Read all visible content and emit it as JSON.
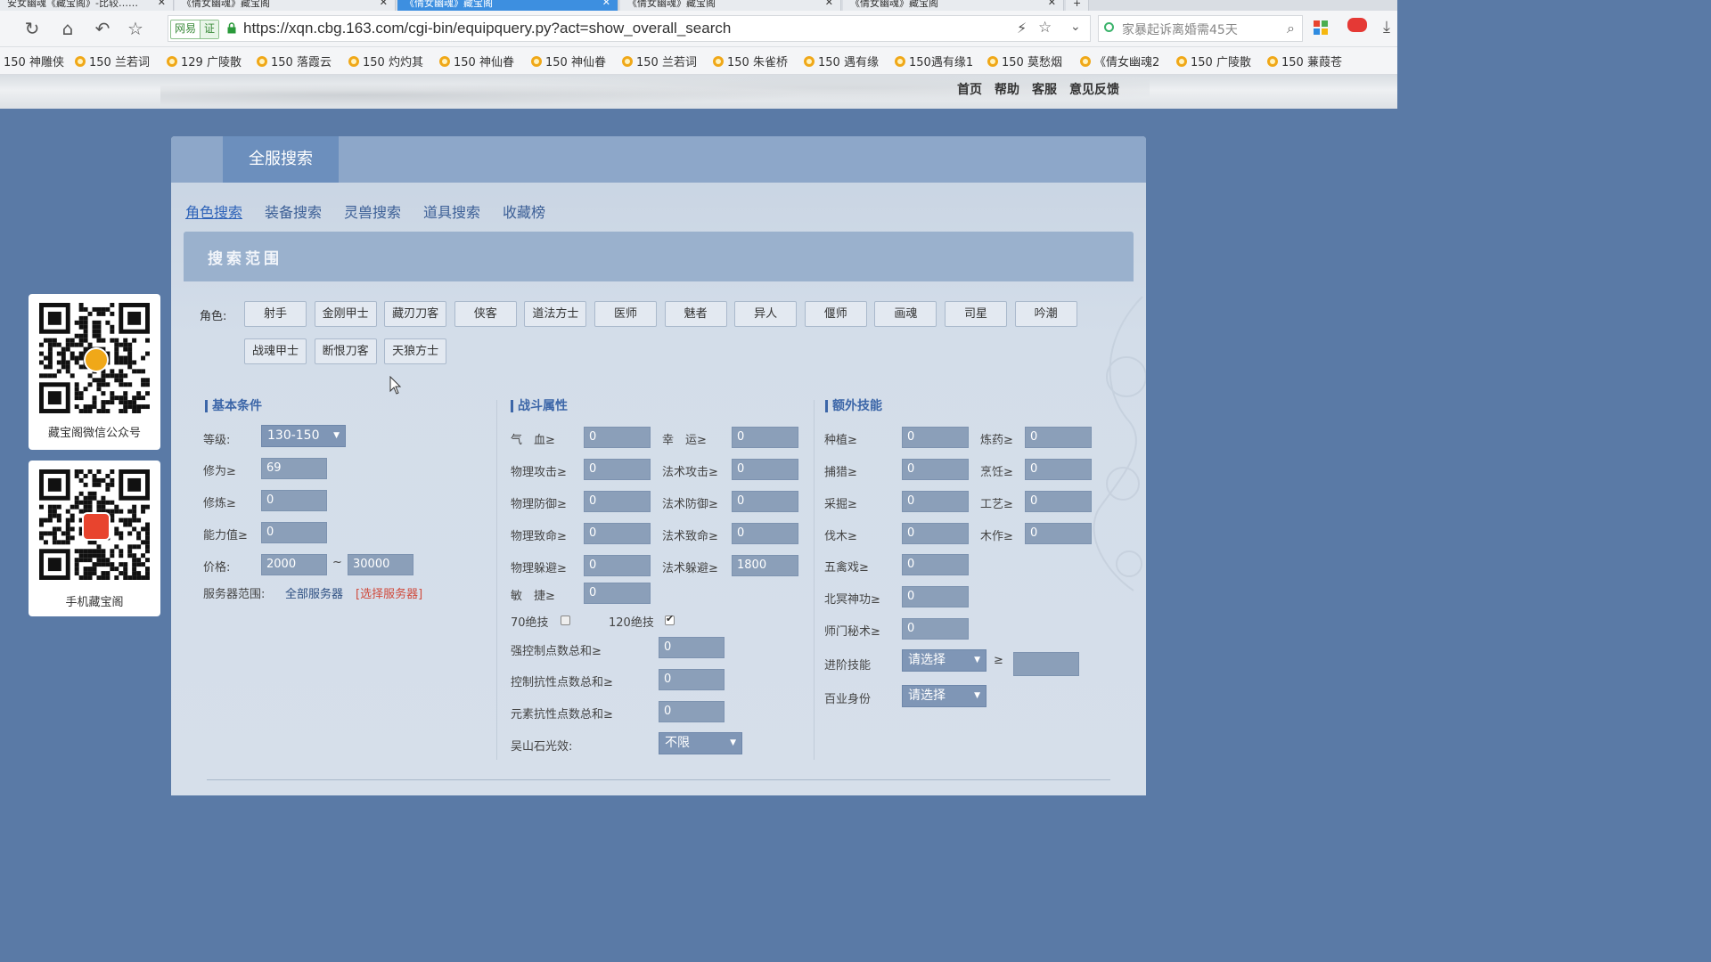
{
  "browser": {
    "tabs": [
      {
        "label": "安女幽魂《藏宝阁》-比较……"
      },
      {
        "label": "《倩女幽魂》藏宝阁"
      },
      {
        "label": "《倩女幽魂》藏宝阁",
        "active": true
      },
      {
        "label": "《倩女幽魂》藏宝阁"
      },
      {
        "label": "《倩女幽魂》藏宝阁"
      }
    ],
    "security_badge": [
      "网易",
      "证"
    ],
    "url": "https://xqn.cbg.163.com/cgi-bin/equipquery.py?act=show_overall_search",
    "search_placeholder": "家暴起诉离婚需45天",
    "bookmarks": [
      "150 神雕侠",
      "150 兰若词",
      "129 广陵散",
      "150 落霞云",
      "150 灼灼其",
      "150 神仙眷",
      "150 神仙眷",
      "150 兰若词",
      "150 朱雀桥",
      "150 遇有缘",
      "150遇有缘1",
      "150 莫愁烟",
      "《倩女幽魂2",
      "150 广陵散",
      "150 蒹葭苍"
    ]
  },
  "site_nav": [
    "首页",
    "帮助",
    "客服",
    "意见反馈"
  ],
  "qr_cards": [
    {
      "caption": "藏宝阁微信公众号"
    },
    {
      "caption": "手机藏宝阁"
    }
  ],
  "main_tab": "全服搜索",
  "sub_tabs": [
    "角色搜索",
    "装备搜索",
    "灵兽搜索",
    "道具搜索",
    "收藏榜"
  ],
  "range_title": "搜索范围",
  "roles": {
    "label": "角色:",
    "row1": [
      "射手",
      "金刚甲士",
      "藏刃刀客",
      "侠客",
      "道法方士",
      "医师",
      "魅者",
      "异人",
      "偃师",
      "画魂",
      "司星",
      "吟潮"
    ],
    "row2": [
      "战魂甲士",
      "断恨刀客",
      "天狼方士"
    ]
  },
  "basic": {
    "title": "基本条件",
    "level_label": "等级:",
    "level_value": "130-150",
    "xiuwei_label": "修为≥",
    "xiuwei_value": "69",
    "xiulian_label": "修炼≥",
    "xiulian_value": "0",
    "ability_label": "能力值≥",
    "ability_value": "0",
    "price_label": "价格:",
    "price_min": "2000",
    "price_sep": "~",
    "price_max": "30000",
    "server_label": "服务器范围:",
    "server_value": "全部服务器",
    "server_link": "[选择服务器]"
  },
  "combat": {
    "title": "战斗属性",
    "rows": [
      {
        "l_label": "气　血≥",
        "l_value": "0",
        "r_label": "幸　运≥",
        "r_value": "0"
      },
      {
        "l_label": "物理攻击≥",
        "l_value": "0",
        "r_label": "法术攻击≥",
        "r_value": "0"
      },
      {
        "l_label": "物理防御≥",
        "l_value": "0",
        "r_label": "法术防御≥",
        "r_value": "0"
      },
      {
        "l_label": "物理致命≥",
        "l_value": "0",
        "r_label": "法术致命≥",
        "r_value": "0"
      },
      {
        "l_label": "物理躲避≥",
        "l_value": "0",
        "r_label": "法术躲避≥",
        "r_value": "1800"
      }
    ],
    "agility_label": "敏　捷≥",
    "agility_value": "0",
    "skill70_label": "70绝技",
    "skill70_checked": false,
    "skill120_label": "120绝技",
    "skill120_checked": true,
    "strong_control_label": "强控制点数总和≥",
    "strong_control_value": "0",
    "control_resist_label": "控制抗性点数总和≥",
    "control_resist_value": "0",
    "element_resist_label": "元素抗性点数总和≥",
    "element_resist_value": "0",
    "wushan_label": "吴山石光效:",
    "wushan_value": "不限"
  },
  "extra": {
    "title": "额外技能",
    "pairs": [
      {
        "l_label": "种植≥",
        "l_value": "0",
        "r_label": "炼药≥",
        "r_value": "0"
      },
      {
        "l_label": "捕猎≥",
        "l_value": "0",
        "r_label": "烹饪≥",
        "r_value": "0"
      },
      {
        "l_label": "采掘≥",
        "l_value": "0",
        "r_label": "工艺≥",
        "r_value": "0"
      },
      {
        "l_label": "伐木≥",
        "l_value": "0",
        "r_label": "木作≥",
        "r_value": "0"
      }
    ],
    "singles": [
      {
        "label": "五禽戏≥",
        "value": "0"
      },
      {
        "label": "北冥神功≥",
        "value": "0"
      },
      {
        "label": "师门秘术≥",
        "value": "0"
      }
    ],
    "advanced_label": "进阶技能",
    "advanced_value": "请选择",
    "advanced_ge": "≥",
    "advanced_input": "",
    "identity_label": "百业身份",
    "identity_value": "请选择"
  },
  "colors": {
    "page_bg": "#5a7aa6",
    "panel_head": "#8da7c9",
    "main_tab": "#6c8fbd",
    "input_bg": "#8b9fb9",
    "link": "#3c5f96",
    "accent_red": "#d04a3c"
  }
}
